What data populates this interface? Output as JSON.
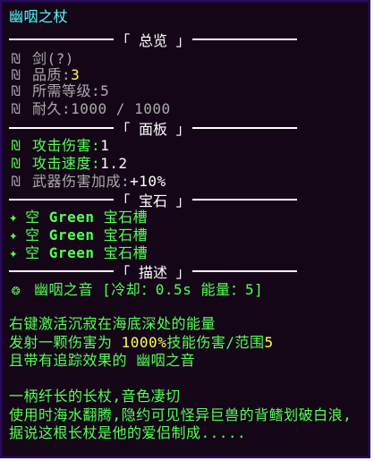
{
  "item": {
    "title": "幽咽之杖"
  },
  "sections": {
    "overview": "「 总览 」",
    "panel": "「 面板 」",
    "gems": "「 宝石 」",
    "desc": "「 描述 」"
  },
  "overview": {
    "type": "剑(?)",
    "quality_label": "品质:",
    "quality_value": "3",
    "level_label": "所需等级:",
    "level_value": "5",
    "durability_label": "耐久:",
    "durability_value": "1000 / 1000"
  },
  "panel": {
    "attack_damage_label": "攻击伤害:",
    "attack_damage_value": "1",
    "attack_speed_label": "攻击速度:",
    "attack_speed_value": "1.2",
    "weapon_bonus_label": "武器伤害加成:",
    "weapon_bonus_value": "+10%"
  },
  "gems": [
    {
      "prefix": "空",
      "color": "Green",
      "suffix": "宝石槽"
    },
    {
      "prefix": "空",
      "color": "Green",
      "suffix": "宝石槽"
    },
    {
      "prefix": "空",
      "color": "Green",
      "suffix": "宝石槽"
    }
  ],
  "ability": {
    "name": "幽咽之音",
    "meta": "[冷却：0.5s 能量：5]"
  },
  "description": {
    "line1": "右键激活沉寂在海底深处的能量",
    "line2a": "发射一颗伤害为",
    "line2b": "1000%",
    "line2c": "技能伤害/范围",
    "line2d": "5",
    "line3a": "且带有追踪效果的",
    "line3b": "幽咽之音",
    "lore1": "一柄纤长的长杖,音色凄切",
    "lore2": "使用时海水翻腾,隐约可见怪异巨兽的背鳍划破白浪,",
    "lore3": "据说这根长杖是他的爱侣制成....."
  },
  "icons": {
    "stat": "bullet-glyph",
    "gem": "diamond-icon",
    "ability": "sparkle-icon"
  },
  "colors": {
    "background": "#140617",
    "border": "#2a0a5c",
    "aqua": "#55ffff",
    "green": "#55ff55",
    "yellow": "#ffff55",
    "gray": "#aaaaaa"
  }
}
